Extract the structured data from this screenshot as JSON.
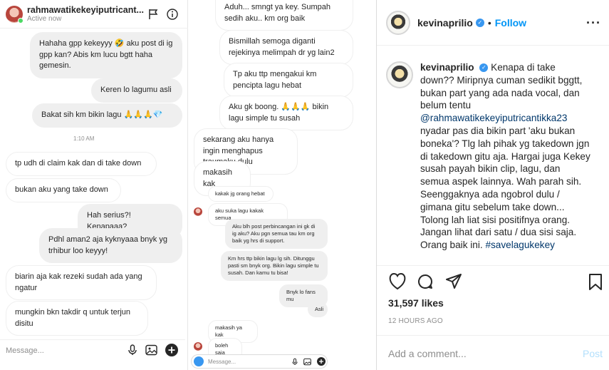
{
  "left_chat": {
    "username": "rahmawatikekeyiputricant...",
    "status": "Active now",
    "messages": [
      "Hahaha gpp kekeyyy 🤣 aku post di ig gpp kan? Abis km lucu bgtt haha gemesin.",
      "Keren lo lagumu asli",
      "Bakat sih km bikin lagu 🙏🙏🙏💎",
      "1:10 AM",
      "tp udh di claim kak dan di take down",
      "bukan aku yang take down",
      "Hah serius?! Kenapaaa?",
      "Pdhl aman2 aja kyknyaaa bnyk yg trhibur loo keyyy!",
      "biarin aja kak rezeki sudah ada yang ngatur",
      "mungkin bkn takdir q untuk terjun disitu"
    ],
    "composer_placeholder": "Message..."
  },
  "right_chat": {
    "messages": [
      "Aduh... smngt ya key. Sumpah sedih aku.. km org baik",
      "Bismillah semoga diganti rejekinya melimpah dr yg lain2",
      "Tp aku ttp mengakui km pencipta lagu hebat",
      "Aku gk boong. 🙏🙏🙏 bikin lagu simple tu susah",
      "sekarang aku hanya ingin menghapus traumaku dulu",
      "makasih kak",
      "kakak jg orang hebat",
      "aku suka lagu kakak semua",
      "Aku blh post perbincangan ini gk di ig aku? Aku pgn semua tau km org baik yg hrs di support.",
      "Km hrs ttp bikin lagu lg sih. Ditunggu pasti sm bnyk org. Bikin lagu simple tu susah. Dan kamu tu bisa!",
      "Bnyk lo fans mu",
      "Asli",
      "makasih ya kak",
      "boleh saja"
    ],
    "composer_placeholder": "Message..."
  },
  "post": {
    "username": "kevinaprilio",
    "follow_label": "Follow",
    "dot": "•",
    "more_label": "···",
    "caption_head": "Kenapa di take down?? Miripnya cuman sedikit bggtt, bukan part yang ada nada vocal, dan belum tentu",
    "caption_mention": "@rahmawatikekeyiputricantikka23",
    "caption_body": "nyadar pas dia bikin part 'aku bukan boneka'? Tlg lah pihak yg takedown jgn di takedown gitu aja. Hargai juga Kekey susah payah bikin clip, lagu, dan semua aspek lainnya. Wah parah sih. Seenggaknya ada ngobrol dulu / gimana gitu sebelum take down... Tolong lah liat sisi positifnya orang. Jangan lihat dari satu / dua sisi saja. Orang baik ini.",
    "caption_hashtag": "#savelagukekey",
    "likes": "31,597 likes",
    "time_ago": "12 HOURS AGO",
    "comment_placeholder": "Add a comment...",
    "post_label": "Post"
  },
  "colors": {
    "accent": "#0095f6",
    "verified": "#3897f0",
    "bubble_me": "#efefef"
  }
}
